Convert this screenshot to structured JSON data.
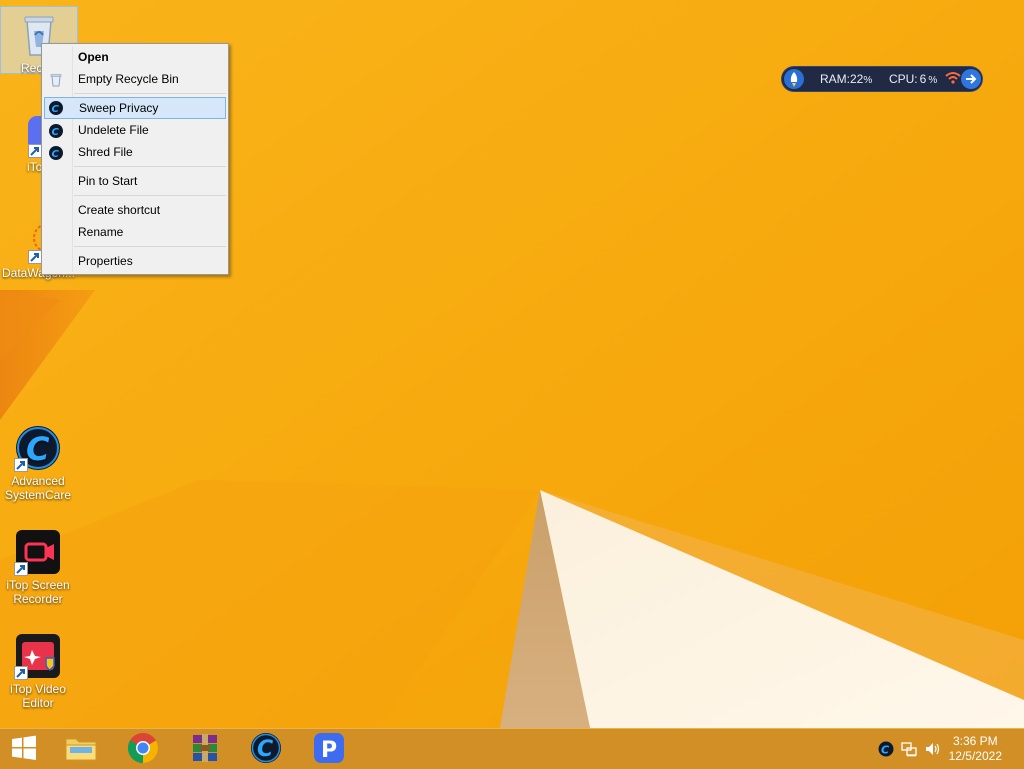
{
  "desktop": {
    "icons": [
      {
        "label": "Recycle Bin",
        "visible_label": "Recycl"
      },
      {
        "label": "iTop"
      },
      {
        "label": "DataWagon..."
      },
      {
        "label": "Advanced SystemCare"
      },
      {
        "label": "iTop Screen Recorder"
      },
      {
        "label": "iTop Video Editor"
      }
    ]
  },
  "context_menu": {
    "items": [
      {
        "label": "Open",
        "icon": "none"
      },
      {
        "label": "Empty Recycle Bin",
        "icon": "recycle-bin-icon"
      },
      {
        "label": "Sweep Privacy",
        "icon": "advanced-systemcare-icon"
      },
      {
        "label": "Undelete File",
        "icon": "advanced-systemcare-icon"
      },
      {
        "label": "Shred File",
        "icon": "advanced-systemcare-icon"
      },
      {
        "label": "Pin to Start",
        "icon": "none"
      },
      {
        "label": "Create shortcut",
        "icon": "none"
      },
      {
        "label": "Rename",
        "icon": "none"
      },
      {
        "label": "Properties",
        "icon": "none"
      }
    ],
    "hovered": "Sweep Privacy"
  },
  "widget": {
    "ram_label": "RAM:",
    "ram_value": "22",
    "cpu_label": "CPU:",
    "cpu_value": "6",
    "unit": "%"
  },
  "taskbar": {
    "apps": [
      "start-button",
      "file-explorer",
      "google-chrome",
      "winrar",
      "advanced-systemcare",
      "pdf-app"
    ],
    "clock_time": "3:36 PM",
    "clock_date": "12/5/2022"
  },
  "colors": {
    "accent": "#f8ad10",
    "menu_hover": "#d5e7f8",
    "widget_bg": "#202a44"
  }
}
